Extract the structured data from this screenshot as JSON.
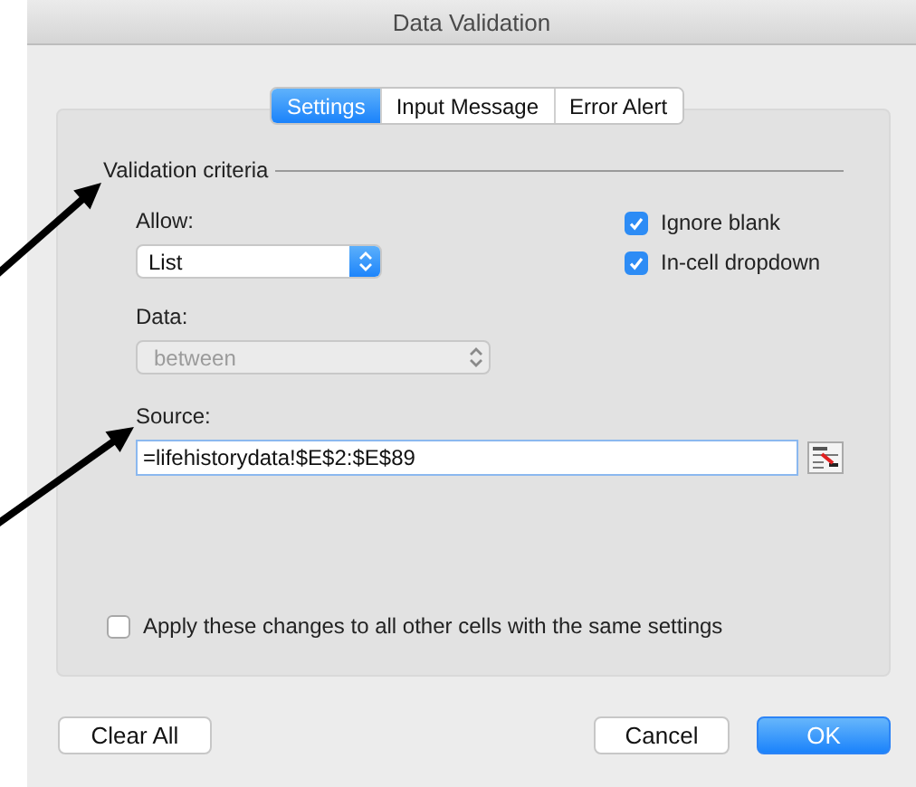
{
  "window": {
    "title": "Data Validation"
  },
  "tabs": [
    {
      "label": "Settings",
      "selected": true
    },
    {
      "label": "Input Message",
      "selected": false
    },
    {
      "label": "Error Alert",
      "selected": false
    }
  ],
  "criteria": {
    "heading": "Validation criteria",
    "allow": {
      "label": "Allow:",
      "value": "List",
      "disabled": false
    },
    "data": {
      "label": "Data:",
      "value": "between",
      "disabled": true
    },
    "options": [
      {
        "label": "Ignore blank",
        "checked": true
      },
      {
        "label": "In-cell dropdown",
        "checked": true
      }
    ],
    "source": {
      "label": "Source:",
      "value": "=lifehistorydata!$E$2:$E$89"
    }
  },
  "apply_all": {
    "label": "Apply these changes to all other cells with the same settings",
    "checked": false
  },
  "buttons": [
    {
      "label": "Clear All",
      "kind": "plain"
    },
    {
      "label": "Cancel",
      "kind": "plain"
    },
    {
      "label": "OK",
      "kind": "default"
    }
  ]
}
